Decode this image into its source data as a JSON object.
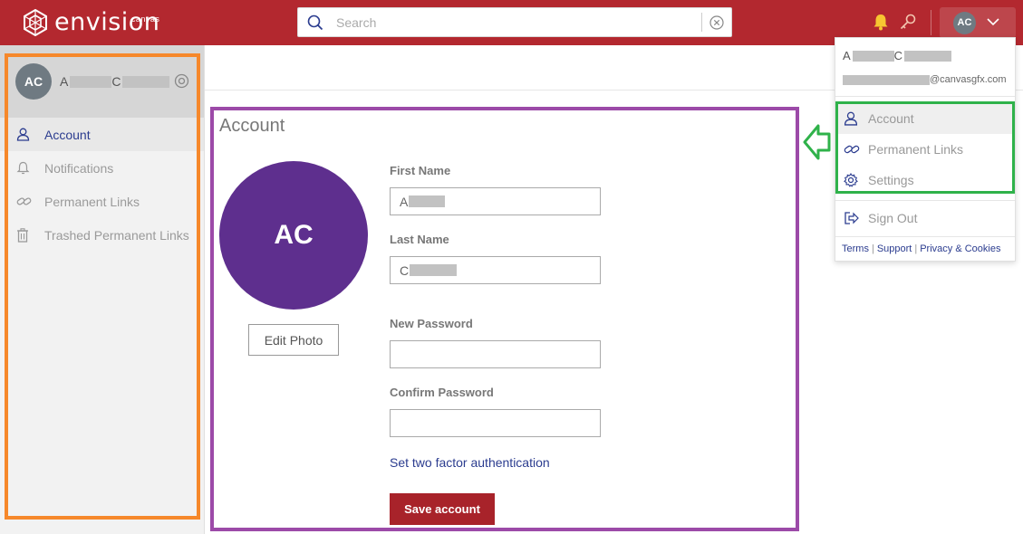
{
  "app": {
    "logo_text": "envision",
    "logo_subtext": "canvas"
  },
  "search": {
    "placeholder": "Search"
  },
  "user": {
    "initials": "AC",
    "first_initial": "A",
    "last_initial": "C",
    "email_suffix": "@canvasgfx.com"
  },
  "sidebar": {
    "items": [
      {
        "label": "Account",
        "icon": "user-icon",
        "active": true
      },
      {
        "label": "Notifications",
        "icon": "bell-icon",
        "active": false
      },
      {
        "label": "Permanent Links",
        "icon": "link-icon",
        "active": false
      },
      {
        "label": "Trashed Permanent Links",
        "icon": "trash-icon",
        "active": false
      }
    ]
  },
  "account": {
    "title": "Account",
    "edit_photo_label": "Edit Photo",
    "first_name_label": "First Name",
    "first_name_value": "A",
    "last_name_label": "Last Name",
    "last_name_value": "C",
    "new_password_label": "New Password",
    "confirm_password_label": "Confirm Password",
    "two_factor_link": "Set two factor authentication",
    "save_label": "Save account"
  },
  "dropdown": {
    "items": [
      {
        "label": "Account",
        "icon": "user-icon"
      },
      {
        "label": "Permanent Links",
        "icon": "link-icon"
      },
      {
        "label": "Settings",
        "icon": "gear-icon"
      }
    ],
    "sign_out_label": "Sign Out",
    "sign_out_icon": "sign-out-icon",
    "footer_links": [
      "Terms",
      "Support",
      "Privacy & Cookies"
    ]
  },
  "colors": {
    "brand_red": "#b3282f",
    "save_red": "#a8232a",
    "avatar_purple": "#5e2f8e",
    "link_blue": "#2b3c8f",
    "annotation_orange": "#f6882b",
    "annotation_purple": "#9c4aa8",
    "annotation_green": "#2fb24a"
  }
}
